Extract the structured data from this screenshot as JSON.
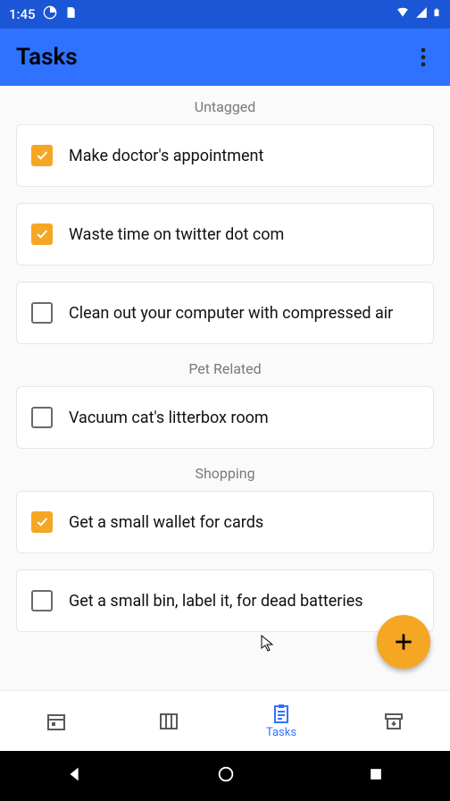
{
  "statusbar": {
    "time": "1:45"
  },
  "appbar": {
    "title": "Tasks"
  },
  "sections": [
    {
      "header": "Untagged",
      "tasks": [
        {
          "label": "Make doctor's appointment",
          "checked": true
        },
        {
          "label": "Waste time on twitter dot com",
          "checked": true
        },
        {
          "label": "Clean out your computer with compressed air",
          "checked": false
        }
      ]
    },
    {
      "header": "Pet Related",
      "tasks": [
        {
          "label": "Vacuum cat's litterbox room",
          "checked": false
        }
      ]
    },
    {
      "header": "Shopping",
      "tasks": [
        {
          "label": "Get a small wallet for cards",
          "checked": true
        },
        {
          "label": "Get a small bin, label it, for dead batteries",
          "checked": false
        }
      ]
    }
  ],
  "bottomnav": {
    "active_label": "Tasks"
  },
  "colors": {
    "accent": "#2f72ff",
    "checkbox": "#f5a623"
  }
}
